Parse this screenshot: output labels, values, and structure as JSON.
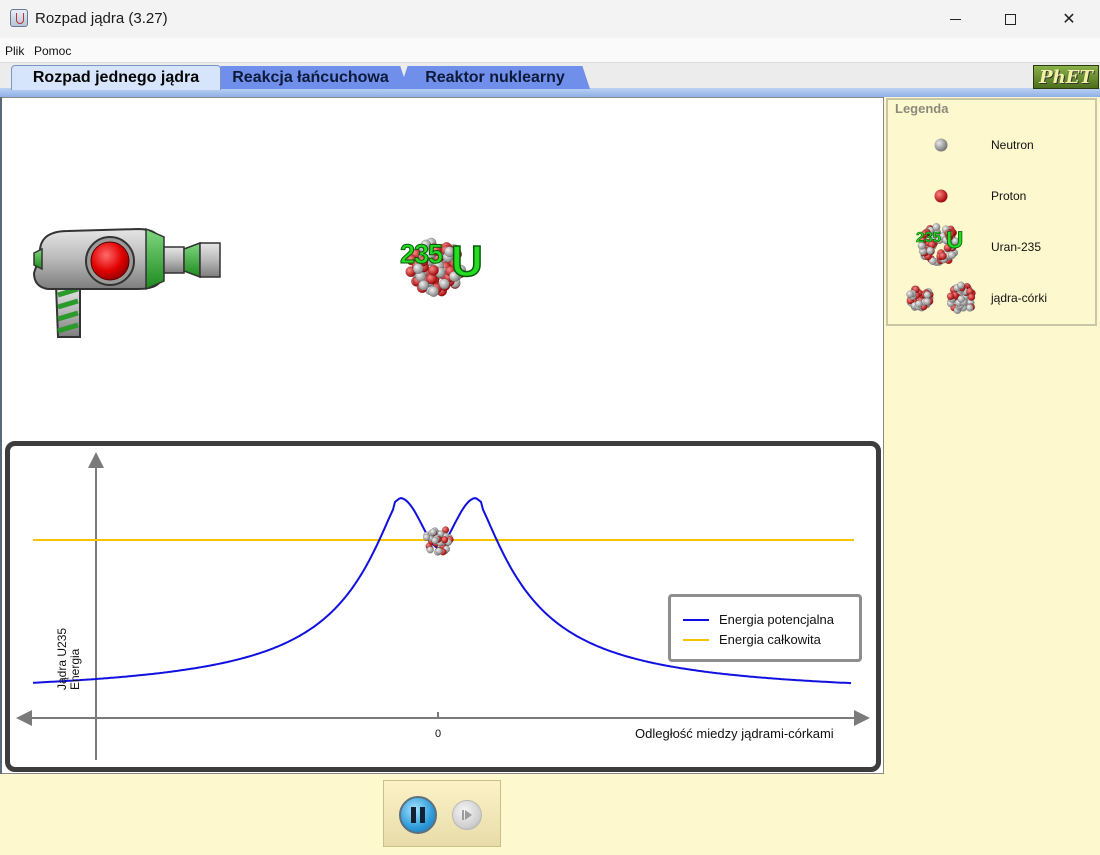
{
  "window": {
    "title": "Rozpad jądra (3.27)",
    "min_label": "",
    "close_label": "✕"
  },
  "menu": {
    "items": [
      "Plik",
      "Pomoc"
    ]
  },
  "tabs": [
    {
      "label": "Rozpad jednego jądra",
      "active": true
    },
    {
      "label": "Reakcja łańcuchowa",
      "active": false
    },
    {
      "label": "Reaktor nuklearny",
      "active": false
    }
  ],
  "logo": {
    "text": "PhET"
  },
  "nucleus": {
    "mass_number": "235",
    "symbol": "U"
  },
  "chart": {
    "y_label_line1": "Jądra U235",
    "y_label_line2": "Energia",
    "x_label": "Odległość miedzy jądrami-córkami",
    "x_tick_zero": "0",
    "legend": [
      {
        "label": "Energia potencjalna",
        "color": "#1010e0"
      },
      {
        "label": "Energia całkowita",
        "color": "#f5c400"
      }
    ]
  },
  "side_legend": {
    "title": "Legenda",
    "items": [
      {
        "label": "Neutron",
        "icon": "neutron-icon"
      },
      {
        "label": "Proton",
        "icon": "proton-icon"
      },
      {
        "label": "Uran-235",
        "icon": "uranium-235-icon",
        "mass_number": "235",
        "symbol": "U"
      },
      {
        "label": "jądra-córki",
        "icon": "daughter-nuclei-icon"
      }
    ]
  },
  "controls": {
    "pause": "pause",
    "step": "step"
  },
  "colors": {
    "potential_energy": "#1010e0",
    "total_energy": "#f5c400",
    "proton": "#c21818",
    "neutron": "#9a9a9a",
    "background": "#fef8cf"
  }
}
